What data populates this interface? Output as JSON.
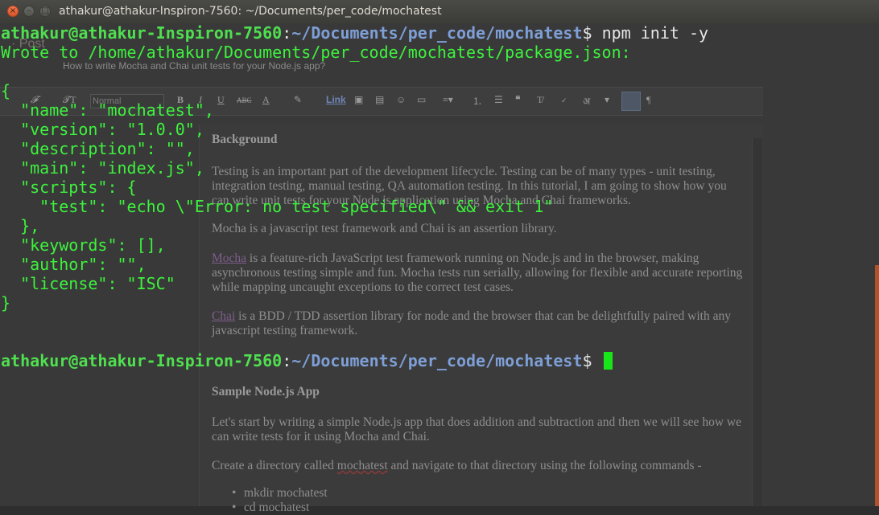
{
  "window": {
    "title": "athakur@athakur-Inspiron-7560: ~/Documents/per_code/mochatest",
    "close_glyph": "×",
    "minimize_glyph": "–",
    "maximize_glyph": "□"
  },
  "background_page": {
    "tab_label": "· Post",
    "post_title": "How to write Mocha and Chai unit tests for your Node.js app?",
    "toolbar": {
      "format_select_value": "Normal",
      "font_label": "𝓕",
      "size_label": "𝓣T",
      "bold": "B",
      "italic": "I",
      "underline": "U",
      "strike": "ABC",
      "text_color": "A",
      "link_label": "Link",
      "hindi_label": "अ"
    },
    "editor": {
      "heading_background": "Background",
      "para_testing": "Testing is an important part of the development lifecycle. Testing can be of many types - unit testing, integration testing, manual testing, QA automation testing. In this tutorial, I am going to show how you can write unit tests for your Node.js application using Mocha and Chai frameworks.",
      "para_mocha_chai": "Mocha is a javascript test framework and Chai is an assertion library.",
      "mocha_link": "Mocha",
      "para_mocha_desc": " is a feature-rich JavaScript test framework running on Node.js and in the browser, making asynchronous testing simple and fun. Mocha tests run serially, allowing for flexible and accurate reporting while mapping uncaught exceptions to the correct test cases.",
      "chai_link": "Chai",
      "para_chai_desc": " is a BDD / TDD assertion library for node and the browser that can be delightfully paired with any javascript testing framework.",
      "heading_sample": "Sample Node.js App",
      "para_start": "Let's start by writing a simple Node.js app that does addition and subtraction and then we will see how we can write tests for it using Mocha and Chai.",
      "para_create_pre": "Create a directory called ",
      "para_create_word": "mochatest",
      "para_create_post": " and navigate to that directory using the following commands -",
      "bullet_1": "mkdir mochatest",
      "bullet_2": "cd mochatest"
    }
  },
  "terminal": {
    "prompt_user": "athakur@athakur-Inspiron-7560",
    "prompt_sep": ":",
    "prompt_path": "~/Documents/per_code/mochatest",
    "prompt_dollar": "$ ",
    "command": "npm init -y",
    "wrote_line": "Wrote to /home/athakur/Documents/per_code/mochatest/package.json:",
    "json_lines": [
      "{",
      "  \"name\": \"mochatest\",",
      "  \"version\": \"1.0.0\",",
      "  \"description\": \"\",",
      "  \"main\": \"index.js\",",
      "  \"scripts\": {",
      "    \"test\": \"echo \\\"Error: no test specified\\\" && exit 1\"",
      "  },",
      "  \"keywords\": [],",
      "  \"author\": \"\",",
      "  \"license\": \"ISC\"",
      "}"
    ]
  },
  "colors": {
    "prompt_user": "#4fe04f",
    "prompt_path": "#7e9fd6",
    "output_green": "#3df23d",
    "cursor": "#19e619",
    "close_button": "#e0603a"
  }
}
